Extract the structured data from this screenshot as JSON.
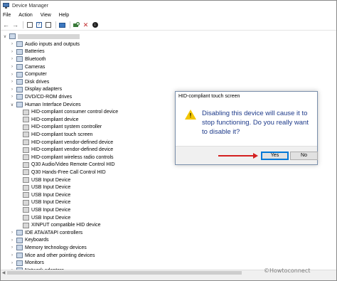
{
  "window": {
    "title": "Device Manager",
    "menu": [
      "File",
      "Action",
      "View",
      "Help"
    ]
  },
  "toolbar": {
    "buttons": [
      "back-arrow-icon",
      "forward-arrow-icon",
      "properties-icon",
      "help-icon",
      "update-driver-icon",
      "scan-hardware-icon",
      "uninstall-icon",
      "disable-device-icon"
    ]
  },
  "tree": {
    "categories_top": [
      {
        "label": "Audio inputs and outputs",
        "expanded": false
      },
      {
        "label": "Batteries",
        "expanded": false
      },
      {
        "label": "Bluetooth",
        "expanded": false
      },
      {
        "label": "Cameras",
        "expanded": false
      },
      {
        "label": "Computer",
        "expanded": false
      },
      {
        "label": "Disk drives",
        "expanded": false
      },
      {
        "label": "Display adapters",
        "expanded": false
      },
      {
        "label": "DVD/CD-ROM drives",
        "expanded": false
      },
      {
        "label": "Human Interface Devices",
        "expanded": true
      }
    ],
    "hid_children": [
      "HID-compliant consumer control device",
      "HID-compliant device",
      "HID-compliant system controller",
      "HID-compliant touch screen",
      "HID-compliant vendor-defined device",
      "HID-compliant vendor-defined device",
      "HID-compliant wireless radio controls",
      "Q30 Audio/Video Remote Control HID",
      "Q30 Hands-Free Call Control HID",
      "USB Input Device",
      "USB Input Device",
      "USB Input Device",
      "USB Input Device",
      "USB Input Device",
      "USB Input Device",
      "XINPUT compatible HID device"
    ],
    "categories_bottom": [
      {
        "label": "IDE ATA/ATAPI controllers",
        "expanded": false
      },
      {
        "label": "Keyboards",
        "expanded": false
      },
      {
        "label": "Memory technology devices",
        "expanded": false
      },
      {
        "label": "Mice and other pointing devices",
        "expanded": false
      },
      {
        "label": "Monitors",
        "expanded": false
      },
      {
        "label": "Network adapters",
        "expanded": false
      }
    ]
  },
  "dialog": {
    "title": "HID-compliant touch screen",
    "message": "Disabling this device will cause it to stop functioning. Do you really want to disable it?",
    "yes_label": "Yes",
    "no_label": "No",
    "icon": "warning-icon"
  },
  "annotation": {
    "arrow_color": "#d42020"
  },
  "watermark": {
    "text": "©Howtoconnect"
  }
}
